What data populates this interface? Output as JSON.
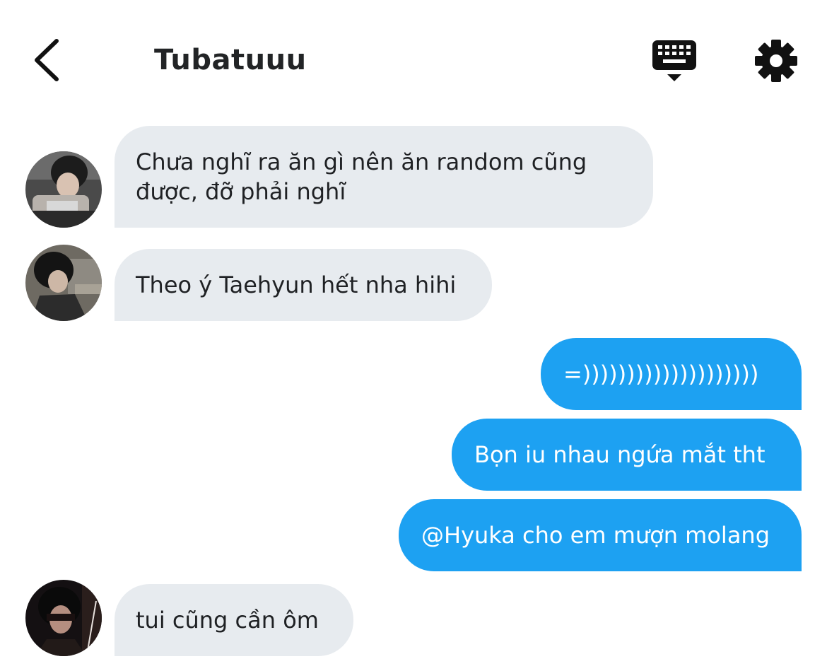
{
  "header": {
    "title": "Tubatuuu",
    "back_icon": "chevron-left-icon",
    "keyboard_icon": "keyboard-hide-icon",
    "settings_icon": "gear-icon"
  },
  "colors": {
    "incoming_bubble": "#e7ebef",
    "outgoing_bubble": "#1da1f2",
    "incoming_text": "#1f2124",
    "outgoing_text": "#ffffff"
  },
  "messages": [
    {
      "direction": "incoming",
      "lines": [
        "Chưa nghĩ ra ăn gì nên ăn random cũng",
        "được, đỡ phải nghĩ"
      ]
    },
    {
      "direction": "incoming",
      "lines": [
        "Theo ý Taehyun hết nha hihi"
      ]
    },
    {
      "direction": "outgoing",
      "lines": [
        "=))))))))))))))))))))"
      ]
    },
    {
      "direction": "outgoing",
      "lines": [
        "Bọn iu nhau ngứa mắt tht"
      ]
    },
    {
      "direction": "outgoing",
      "lines": [
        "@Hyuka cho em mượn molang"
      ]
    },
    {
      "direction": "incoming",
      "lines": [
        "tui cũng cần ôm"
      ]
    }
  ]
}
